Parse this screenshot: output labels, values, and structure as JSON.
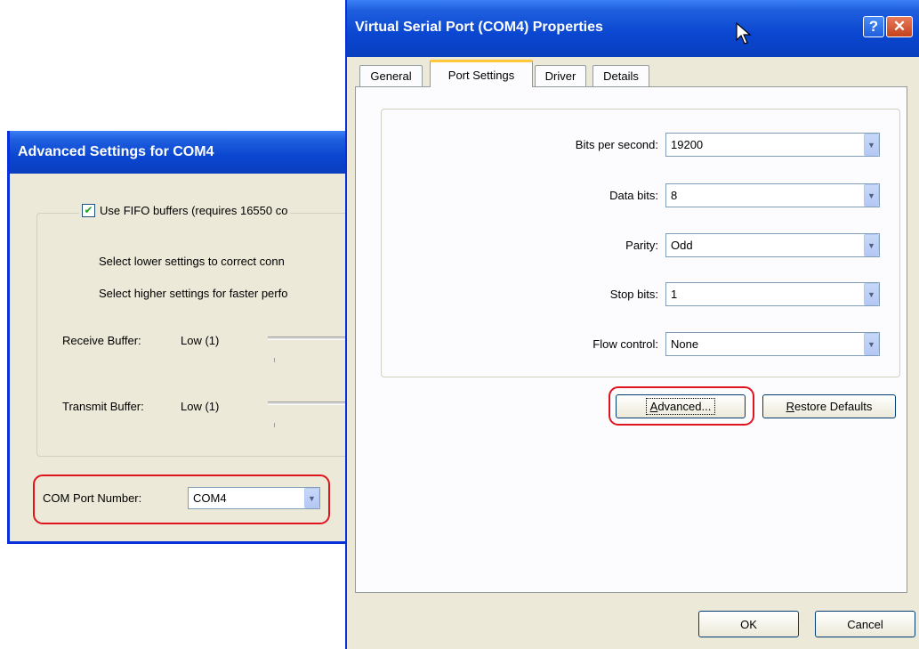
{
  "advanced_window": {
    "title": "Advanced Settings for COM4",
    "fifo_label": "Use FIFO buffers (requires 16550 co",
    "fifo_checked": true,
    "hint_lower": "Select lower settings to correct conn",
    "hint_higher": "Select higher settings for faster perfo",
    "receive_label": "Receive Buffer:",
    "receive_value": "Low (1)",
    "transmit_label": "Transmit Buffer:",
    "transmit_value": "Low (1)",
    "com_port_label": "COM Port Number:",
    "com_port_value": "COM4"
  },
  "properties_window": {
    "title": "Virtual Serial Port (COM4) Properties",
    "help_glyph": "?",
    "close_glyph": "✕",
    "tabs": [
      {
        "label": "General"
      },
      {
        "label": "Port Settings"
      },
      {
        "label": "Driver"
      },
      {
        "label": "Details"
      }
    ],
    "active_tab": "Port Settings",
    "fields": [
      {
        "label": "Bits per second:",
        "value": "19200"
      },
      {
        "label": "Data bits:",
        "value": "8"
      },
      {
        "label": "Parity:",
        "value": "Odd"
      },
      {
        "label": "Stop bits:",
        "value": "1"
      },
      {
        "label": "Flow control:",
        "value": "None"
      }
    ],
    "advanced_button": {
      "access_key": "A",
      "rest": "dvanced..."
    },
    "restore_button": {
      "access_key": "R",
      "rest": "estore Defaults"
    },
    "ok_label": "OK",
    "cancel_label": "Cancel"
  },
  "icons": {
    "dropdown": "chevron-down-icon",
    "checkbox": "checkmark-icon",
    "cursor": "mouse-pointer-icon"
  },
  "colors": {
    "title_bar": "#0a46d0",
    "window_bg": "#ece9d8",
    "highlight_ring": "#e0141e",
    "active_tab_accent": "#ffc83c"
  }
}
